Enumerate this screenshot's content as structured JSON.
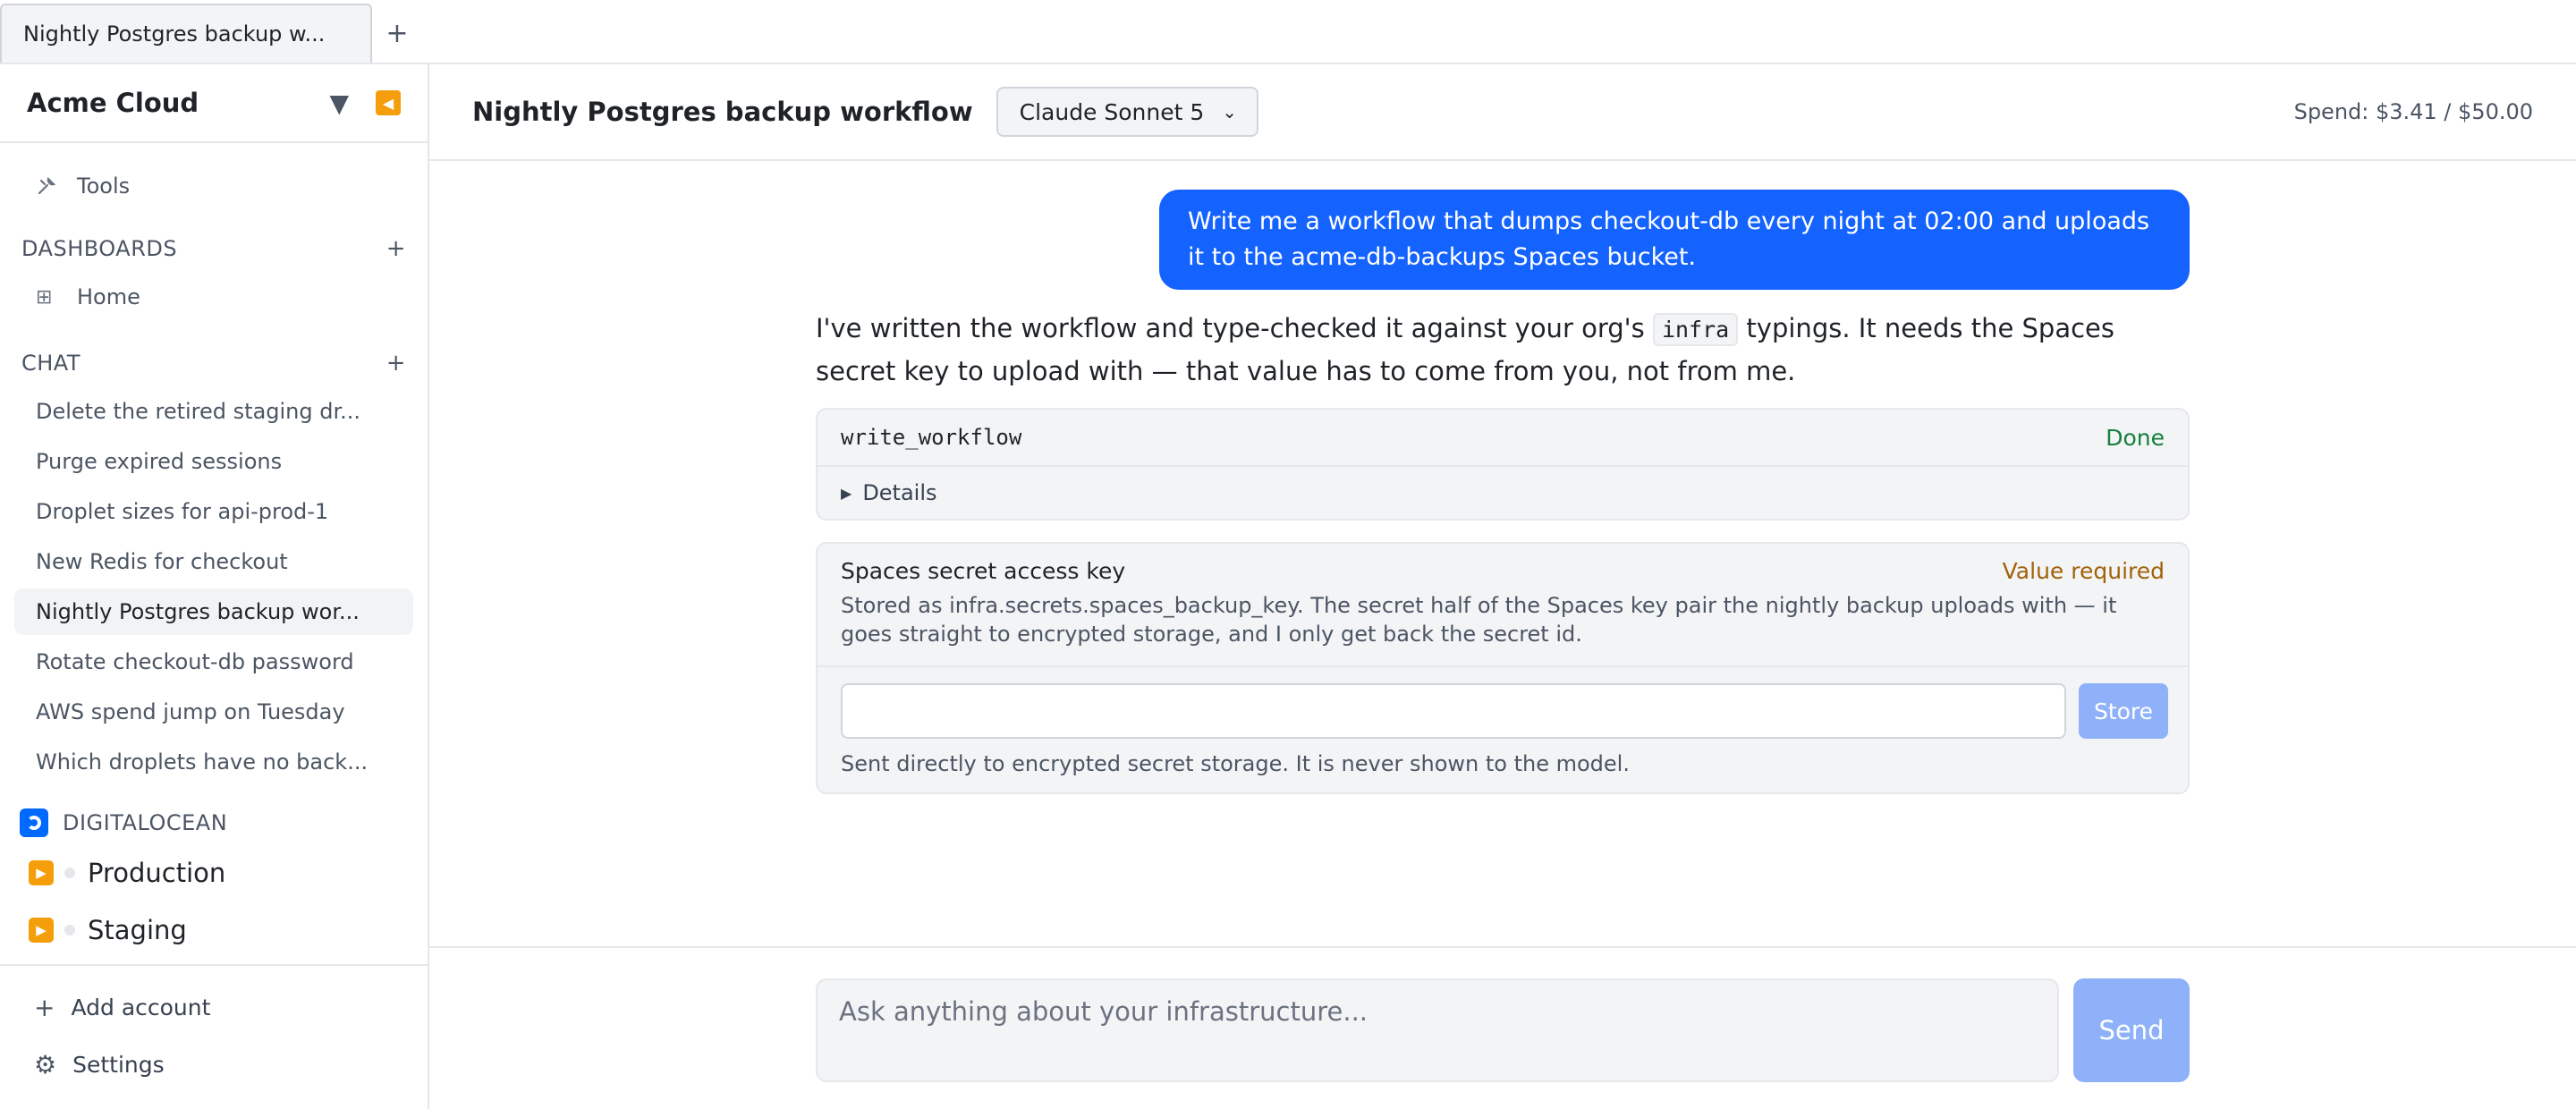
{
  "tabs": [
    {
      "label": "Nightly Postgres backup w..."
    }
  ],
  "sidebar": {
    "org_name": "Acme Cloud",
    "tools_label": "Tools",
    "dashboards": {
      "header": "DASHBOARDS",
      "items": [
        {
          "label": "Home"
        }
      ]
    },
    "chat": {
      "header": "CHAT",
      "items": [
        {
          "label": "Delete the retired staging dr..."
        },
        {
          "label": "Purge expired sessions"
        },
        {
          "label": "Droplet sizes for api-prod-1"
        },
        {
          "label": "New Redis for checkout"
        },
        {
          "label": "Nightly Postgres backup wor...",
          "active": true
        },
        {
          "label": "Rotate checkout-db password"
        },
        {
          "label": "AWS spend jump on Tuesday"
        },
        {
          "label": "Which droplets have no back..."
        }
      ]
    },
    "provider": {
      "header": "DIGITALOCEAN",
      "accounts": [
        {
          "label": "Production"
        },
        {
          "label": "Staging"
        }
      ]
    },
    "add_account_label": "Add account",
    "settings_label": "Settings"
  },
  "header": {
    "title": "Nightly Postgres backup workflow",
    "model": "Claude Sonnet 5",
    "spend": "Spend: $3.41 / $50.00"
  },
  "conversation": {
    "user_message": "Write me a workflow that dumps checkout-db every night at 02:00 and uploads it to the acme-db-backups Spaces bucket.",
    "assistant_pre": "I've written the workflow and type-checked it against your org's ",
    "assistant_code": "infra",
    "assistant_post": " typings. It needs the Spaces secret key to upload with — that value has to come from you, not from me.",
    "tool_call": {
      "name": "write_workflow",
      "status": "Done",
      "details_label": "Details"
    },
    "secret_request": {
      "title": "Spaces secret access key",
      "status": "Value required",
      "description": "Stored as infra.secrets.spaces_backup_key. The secret half of the Spaces key pair the nightly backup uploads with — it goes straight to encrypted storage, and I only get back the secret id.",
      "input_value": "",
      "store_label": "Store",
      "note": "Sent directly to encrypted secret storage. It is never shown to the model."
    }
  },
  "composer": {
    "placeholder": "Ask anything about your infrastructure...",
    "send_label": "Send"
  },
  "colors": {
    "accent": "#1463ff",
    "accent_disabled": "#8fb1f9",
    "success": "#15803d",
    "warning": "#a16207",
    "brand_orange": "#f59e0b",
    "digitalocean_blue": "#0069ff"
  },
  "icons": {
    "tools": "wrench-icon",
    "dashboard_item": "grid-icon",
    "add": "plus-icon",
    "org_menu": "chevron-down-icon",
    "collapse": "collapse-left-icon",
    "provider": "digitalocean-icon",
    "account": "play-icon",
    "settings": "gear-icon",
    "details": "disclosure-triangle-icon"
  }
}
